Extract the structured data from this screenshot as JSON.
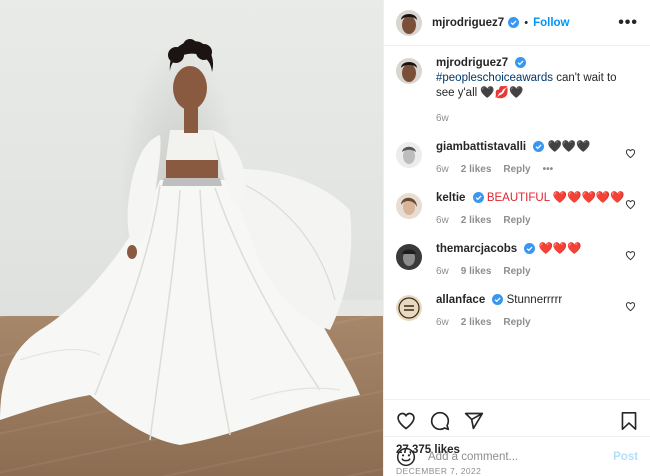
{
  "post": {
    "image_alt": "Woman in flowing white gown",
    "author": {
      "username": "mjrodriguez7",
      "verified": true,
      "follow_label": "Follow",
      "separator": "•",
      "more_label": "•••"
    },
    "caption": {
      "username": "mjrodriguez7",
      "hashtag": "#peopleschoiceawards",
      "text": " can't wait to see y'all ",
      "emojis": "🖤💋🖤",
      "age": "6w"
    },
    "comments": [
      {
        "username": "giambattistavalli",
        "text": "🖤🖤🖤",
        "age": "6w",
        "likes": "2 likes",
        "reply": "Reply",
        "extra": "•••"
      },
      {
        "username": "keltie",
        "text": "BEAUTIFUL ❤️❤️❤️❤️❤️",
        "age": "6w",
        "likes": "2 likes",
        "reply": "Reply"
      },
      {
        "username": "themarcjacobs",
        "text": "❤️❤️❤️",
        "age": "6w",
        "likes": "9 likes",
        "reply": "Reply"
      },
      {
        "username": "allanface",
        "text": "Stunnerrrrr",
        "age": "6w",
        "likes": "2 likes",
        "reply": "Reply"
      }
    ],
    "likes_count": "27,375 likes",
    "date": "DECEMBER 7, 2022",
    "add_comment": {
      "placeholder": "Add a comment...",
      "post_label": "Post"
    }
  },
  "colors": {
    "accent": "#0095f6",
    "verified": "#3897f0",
    "post_disabled": "#b2dffc",
    "muted": "#8e8e8e"
  },
  "icons": [
    "verified-badge-icon",
    "heart-icon",
    "comment-icon",
    "share-icon",
    "bookmark-icon",
    "emoji-icon",
    "more-icon"
  ]
}
